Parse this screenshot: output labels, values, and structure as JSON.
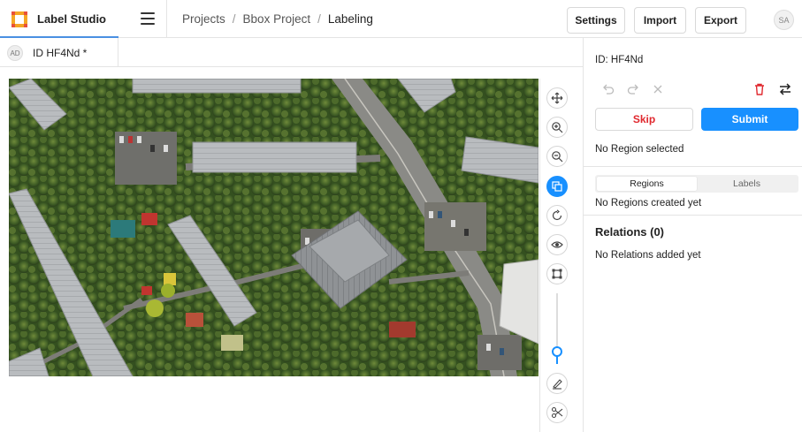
{
  "app": {
    "name": "Label Studio",
    "accent": "#4a90e2"
  },
  "breadcrumb": [
    {
      "label": "Projects"
    },
    {
      "label": "Bbox Project"
    },
    {
      "label": "Labeling"
    }
  ],
  "breadcrumb_separator": "/",
  "header_buttons": {
    "settings": "Settings",
    "import": "Import",
    "export": "Export"
  },
  "user": {
    "initials": "SA"
  },
  "task": {
    "annotator_initials": "AD",
    "label": "ID HF4Nd *"
  },
  "image": {
    "alt": "aerial photo of residential buildings and trees"
  },
  "tools": [
    {
      "name": "pan-icon"
    },
    {
      "name": "zoom-in-icon"
    },
    {
      "name": "zoom-out-icon"
    },
    {
      "name": "rectangle-select-icon",
      "active": true
    },
    {
      "name": "rotate-icon"
    },
    {
      "name": "eye-icon"
    },
    {
      "name": "bounding-box-icon"
    },
    {
      "name": "brightness-slider"
    },
    {
      "name": "brush-icon"
    },
    {
      "name": "scissors-icon"
    }
  ],
  "side": {
    "id_label": "ID: HF4Nd",
    "skip_label": "Skip",
    "submit_label": "Submit",
    "no_region": "No Region selected",
    "tabs": {
      "regions": "Regions",
      "labels": "Labels"
    },
    "no_regions": "No Regions created yet",
    "relations_title": "Relations (0)",
    "no_relations": "No Relations added yet"
  },
  "colors": {
    "primary": "#1890ff",
    "danger": "#e0282e"
  }
}
